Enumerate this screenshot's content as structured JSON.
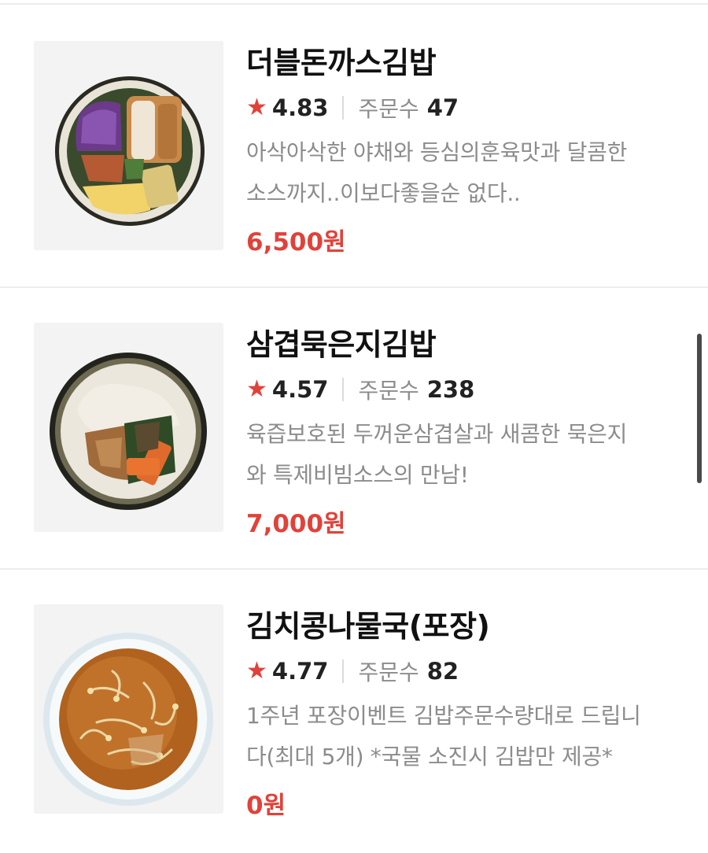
{
  "menu": {
    "items": [
      {
        "name": "더블돈까스김밥",
        "rating": "4.83",
        "order_label": "주문수",
        "order_count": "47",
        "description_lines": [
          "아삭아삭한 야채와 등심의훈육맛과 달콤한",
          "소스까지..이보다좋을순 없다.."
        ],
        "price": "6,500원",
        "image": "kimbap-roll-pork-cutlet"
      },
      {
        "name": "삼겹묵은지김밥",
        "rating": "4.57",
        "order_label": "주문수",
        "order_count": "238",
        "description_lines": [
          "육즙보호된 두꺼운삼겹살과 새콤한 묵은지",
          "와 특제비빔소스의 만남!"
        ],
        "price": "7,000원",
        "image": "kimbap-roll-pork-belly-kimchi"
      },
      {
        "name": "김치콩나물국(포장)",
        "rating": "4.77",
        "order_label": "주문수",
        "order_count": "82",
        "description_lines": [
          "1주년 포장이벤트 김밥주문수량대로 드립니",
          "다(최대 5개) *국물 소진시 김밥만 제공*"
        ],
        "price": "0원",
        "image": "kimchi-bean-sprout-soup"
      }
    ]
  },
  "colors": {
    "accent": "#e0423a",
    "text_primary": "#111111",
    "text_secondary": "#8c8c8c",
    "divider": "#ededed"
  }
}
